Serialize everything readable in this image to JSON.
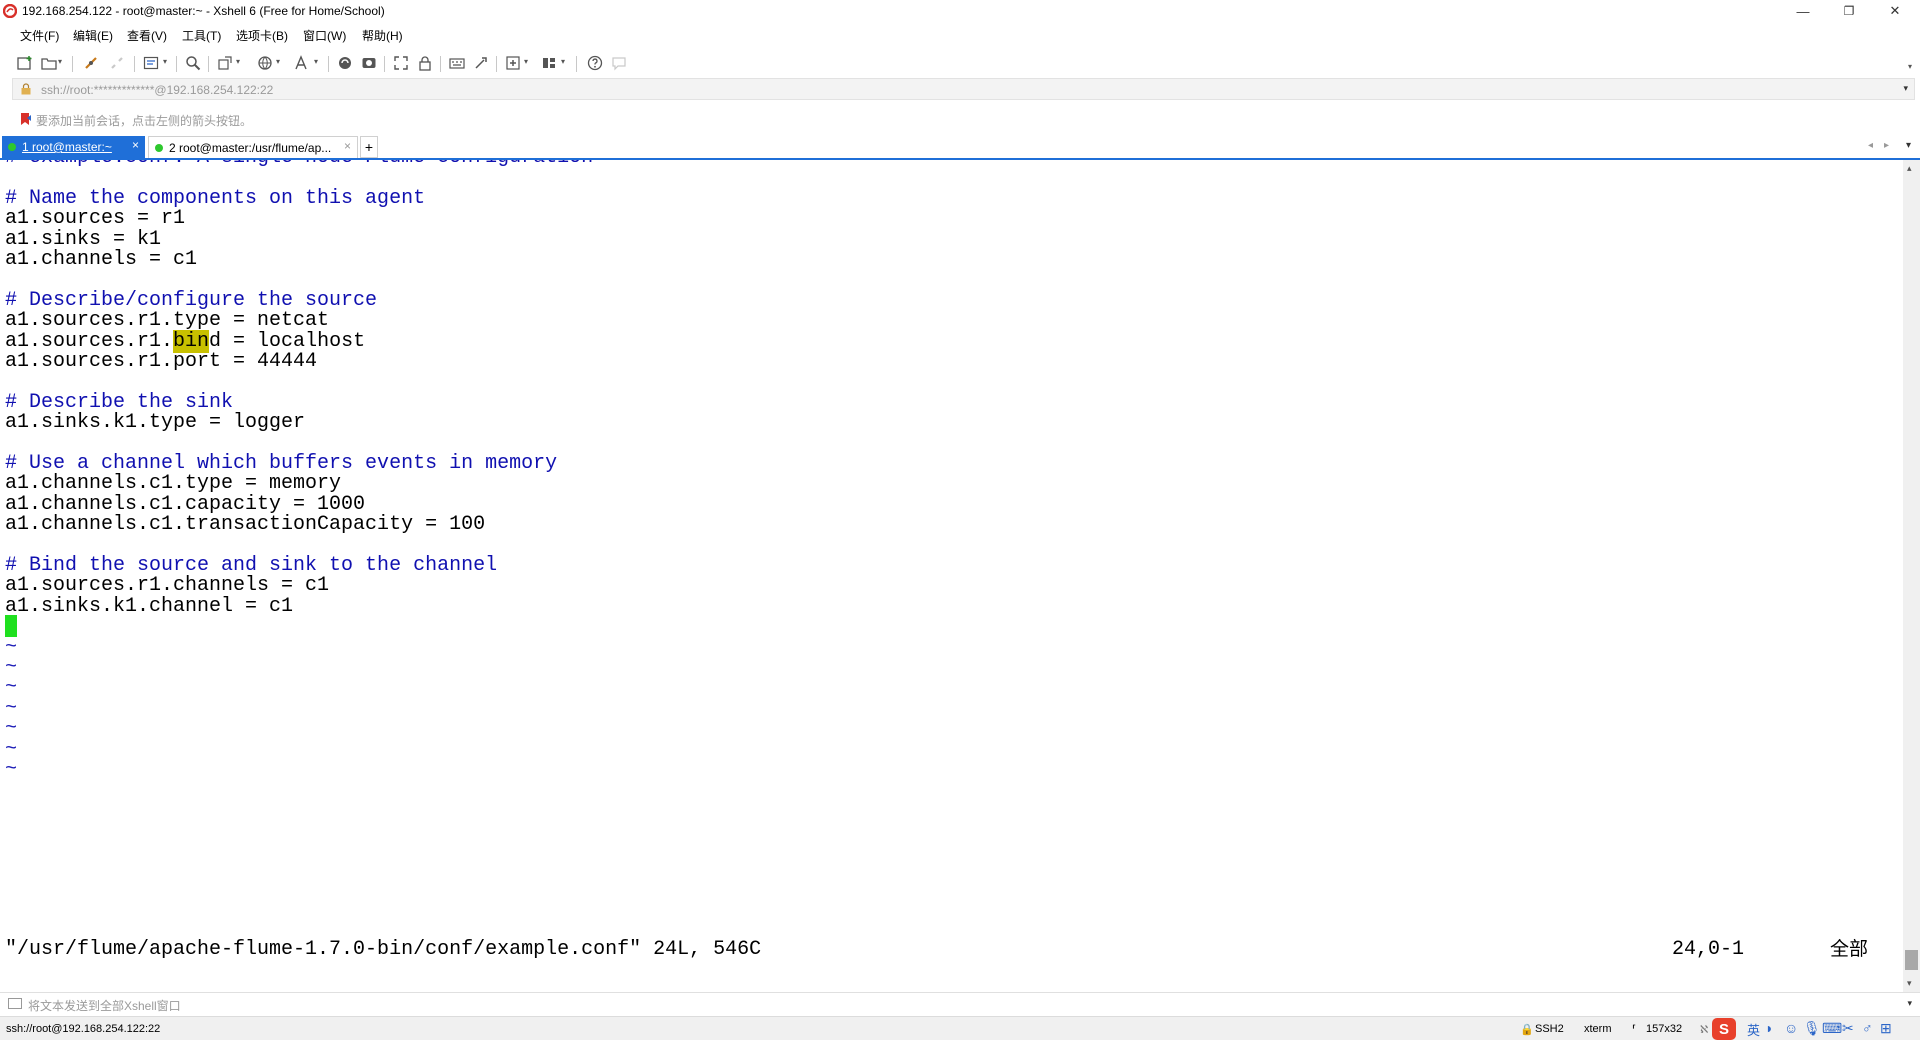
{
  "window": {
    "title": "192.168.254.122 - root@master:~ - Xshell 6 (Free for Home/School)",
    "controls": {
      "minimize": "—",
      "maximize": "❐",
      "close": "✕"
    }
  },
  "menu": [
    "文件(F)",
    "编辑(E)",
    "查看(V)",
    "工具(T)",
    "选项卡(B)",
    "窗口(W)",
    "帮助(H)"
  ],
  "toolbar": {
    "icons": [
      "new-session-icon",
      "open-folder-icon",
      "reconnect-icon",
      "disconnect-icon",
      "properties-icon",
      "find-icon",
      "transfer-icon",
      "globe-icon",
      "font-icon",
      "xftp-icon",
      "record-icon",
      "fullscreen-icon",
      "lock-icon",
      "keyboard-icon",
      "script-icon",
      "add-icon",
      "layout-icon",
      "help-icon",
      "chat-icon"
    ]
  },
  "address": {
    "value": "ssh://root:*************@192.168.254.122:22"
  },
  "hint": {
    "text": "要添加当前会话，点击左侧的箭头按钮。"
  },
  "tabs": [
    {
      "label": "1 root@master:~",
      "active": true,
      "status_color": "#2ec82e",
      "close": "×"
    },
    {
      "label": "2 root@master:/usr/flume/ap...",
      "active": false,
      "status_color": "#2ec82e",
      "close": "×"
    }
  ],
  "tab_add": "+",
  "terminal": {
    "lines": [
      {
        "text": "# example.conf: A single-node Flume configuration",
        "kind": "comment"
      },
      {
        "text": "",
        "kind": "blank"
      },
      {
        "text": "# Name the components on this agent",
        "kind": "comment"
      },
      {
        "text": "a1.sources = r1",
        "kind": "code"
      },
      {
        "text": "a1.sinks = k1",
        "kind": "code"
      },
      {
        "text": "a1.channels = c1",
        "kind": "code"
      },
      {
        "text": "",
        "kind": "blank"
      },
      {
        "text": "# Describe/configure the source",
        "kind": "comment"
      },
      {
        "text": "a1.sources.r1.type = netcat",
        "kind": "code"
      },
      {
        "text": "a1.sources.r1.bind = localhost",
        "kind": "code",
        "highlight": "bin"
      },
      {
        "text": "a1.sources.r1.port = 44444",
        "kind": "code"
      },
      {
        "text": "",
        "kind": "blank"
      },
      {
        "text": "# Describe the sink",
        "kind": "comment"
      },
      {
        "text": "a1.sinks.k1.type = logger",
        "kind": "code"
      },
      {
        "text": "",
        "kind": "blank"
      },
      {
        "text": "# Use a channel which buffers events in memory",
        "kind": "comment"
      },
      {
        "text": "a1.channels.c1.type = memory",
        "kind": "code"
      },
      {
        "text": "a1.channels.c1.capacity = 1000",
        "kind": "code"
      },
      {
        "text": "a1.channels.c1.transactionCapacity = 100",
        "kind": "code"
      },
      {
        "text": "",
        "kind": "blank"
      },
      {
        "text": "# Bind the source and sink to the channel",
        "kind": "comment"
      },
      {
        "text": "a1.sources.r1.channels = c1",
        "kind": "code"
      },
      {
        "text": "a1.sinks.k1.channel = c1",
        "kind": "code"
      },
      {
        "text": "",
        "kind": "cursor"
      },
      {
        "text": "~",
        "kind": "tilde"
      },
      {
        "text": "~",
        "kind": "tilde"
      },
      {
        "text": "~",
        "kind": "tilde"
      },
      {
        "text": "~",
        "kind": "tilde"
      },
      {
        "text": "~",
        "kind": "tilde"
      },
      {
        "text": "~",
        "kind": "tilde"
      },
      {
        "text": "~",
        "kind": "tilde"
      }
    ],
    "status_left": "\"/usr/flume/apache-flume-1.7.0-bin/conf/example.conf\" 24L, 546C",
    "status_pos": "24,0-1",
    "status_all": "全部"
  },
  "compose": {
    "placeholder": "将文本发送到全部Xshell窗口"
  },
  "statusbar": {
    "connection": "ssh://root@192.168.254.122:22",
    "protocol": "SSH2",
    "terminal_type": "xterm",
    "size": "157x32",
    "ime": {
      "logo": "S",
      "lang": "英"
    }
  }
}
